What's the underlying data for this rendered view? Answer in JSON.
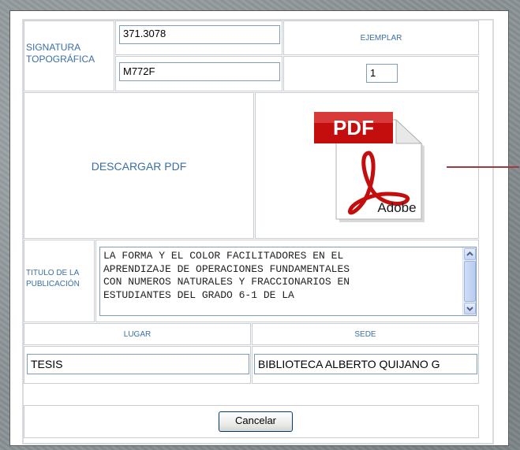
{
  "form": {
    "signatura_label": "SIGNATURA TOPOGRÁFICA",
    "signatura_line1": "371.3078",
    "signatura_line2": "M772F",
    "ejemplar_label": "EJEMPLAR",
    "ejemplar_value": "1",
    "download_label": "DESCARGAR PDF",
    "pdf_icon_text": "PDF",
    "pdf_brand_text": "Adobe",
    "titulo_label": "TITULO DE LA PUBLICACIÓN",
    "titulo_value": "LA FORMA Y EL COLOR FACILITADORES EN EL\nAPRENDIZAJE DE OPERACIONES FUNDAMENTALES\nCON NUMEROS NATURALES Y FRACCIONARIOS EN\nESTUDIANTES DEL GRADO 6-1 DE LA",
    "lugar_label": "LUGAR",
    "lugar_value": "TESIS",
    "sede_label": "SEDE",
    "sede_value": "BIBLIOTECA ALBERTO QUIJANO G",
    "cancel_label": "Cancelar"
  },
  "colors": {
    "label_blue": "#3a6fa4",
    "pdf_red": "#c40d0d",
    "accent_line": "#a33a3a"
  }
}
